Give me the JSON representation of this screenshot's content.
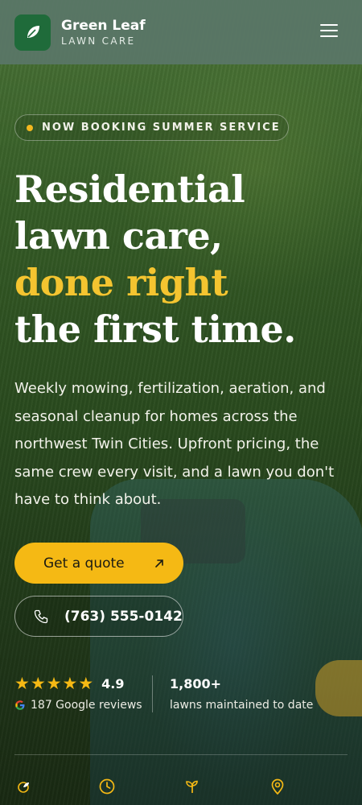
{
  "header": {
    "brand_name": "Green Leaf",
    "brand_sub": "LAWN CARE",
    "logo_icon": "leaf-icon",
    "menu_icon": "hamburger-menu-icon"
  },
  "hero": {
    "badge": "NOW BOOKING SUMMER SERVICE",
    "headline": {
      "line1": "Residential",
      "line2": "lawn care,",
      "line3_accent": "done right",
      "line4": "the first time."
    },
    "description": "Weekly mowing, fertilization, aeration, and seasonal cleanup for homes across the northwest Twin Cities. Upfront pricing, the same crew every visit, and a lawn you don't have to think about.",
    "cta_primary": "Get a quote",
    "cta_phone": "(763) 555-0142"
  },
  "stats": {
    "rating": "4.9",
    "stars": 5,
    "reviews": "187 Google reviews",
    "lawns_count": "1,800+",
    "lawns_label": "lawns maintained to date"
  },
  "bottom_icons": [
    "leaf-badge-icon",
    "clock-icon",
    "sprout-icon",
    "location-pin-icon"
  ],
  "colors": {
    "accent": "#f5b914",
    "headline_accent": "#f4c430",
    "header_bg": "#5a7668",
    "logo_bg": "#1f6b3a"
  }
}
